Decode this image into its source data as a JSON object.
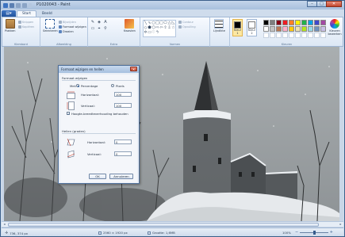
{
  "window": {
    "title": "P1020043 - Paint"
  },
  "tabs": [
    {
      "label": "Start",
      "active": true
    },
    {
      "label": "Beeld",
      "active": false
    }
  ],
  "ribbon": {
    "clipboard": {
      "group_label": "Klembord",
      "paste_label": "Plakken",
      "cut_label": "Knippen",
      "copy_label": "Kopiëren"
    },
    "image": {
      "group_label": "Afbeelding",
      "select_label": "Selecteren",
      "crop_label": "Bijsnijden",
      "resize_label": "Formaat wijzigen",
      "rotate_label": "Draaien"
    },
    "tools": {
      "group_label": "Extra",
      "brushes_label": "Kwasten"
    },
    "shapes": {
      "group_label": "Vormen",
      "outline_label": "Contour",
      "fill_label": "Opvulling"
    },
    "size": {
      "label": "Lijndikte"
    },
    "colors": {
      "group_label": "Kleuren",
      "color1_label": "Kleur 1",
      "color2_label": "Kleur 2",
      "edit_label": "Kleuren bewerken",
      "color1_value": "#000000",
      "color2_value": "#ffffff",
      "palette": [
        "#000000",
        "#7f7f7f",
        "#880015",
        "#ed1c24",
        "#ff7f27",
        "#fff200",
        "#22b14c",
        "#00a2e8",
        "#3f48cc",
        "#a349a4",
        "#ffffff",
        "#c3c3c3",
        "#b97a57",
        "#ffaec9",
        "#ffc90e",
        "#efe4b0",
        "#b5e61d",
        "#99d9ea",
        "#7092be",
        "#c8bfe7",
        "#ffffff",
        "#ffffff",
        "#ffffff",
        "#ffffff",
        "#ffffff",
        "#ffffff",
        "#ffffff",
        "#ffffff",
        "#ffffff",
        "#ffffff"
      ]
    }
  },
  "dialog": {
    "title": "Formaat wijzigen en hellen",
    "resize_section": "Formaat wijzigen",
    "by_label": "Met:",
    "percentage_label": "Percentage",
    "pixels_label": "Pixels",
    "horizontal_label": "Horizontaal:",
    "vertical_label": "Verticaal:",
    "horizontal_value": "100",
    "vertical_value": "100",
    "aspect_label": "Hoogte-breedteverhouding behouden",
    "skew_section": "Hellen (graden)",
    "skew_horizontal_label": "Horizontaal:",
    "skew_vertical_label": "Verticaal:",
    "skew_horizontal_value": "0",
    "skew_vertical_value": "0",
    "ok_label": "OK",
    "cancel_label": "Annuleren"
  },
  "status": {
    "cursor_pos": "736, 374 px",
    "image_size": "2560 × 1920 px",
    "file_size": "Grootte: 1,6MB",
    "zoom": "100%"
  }
}
